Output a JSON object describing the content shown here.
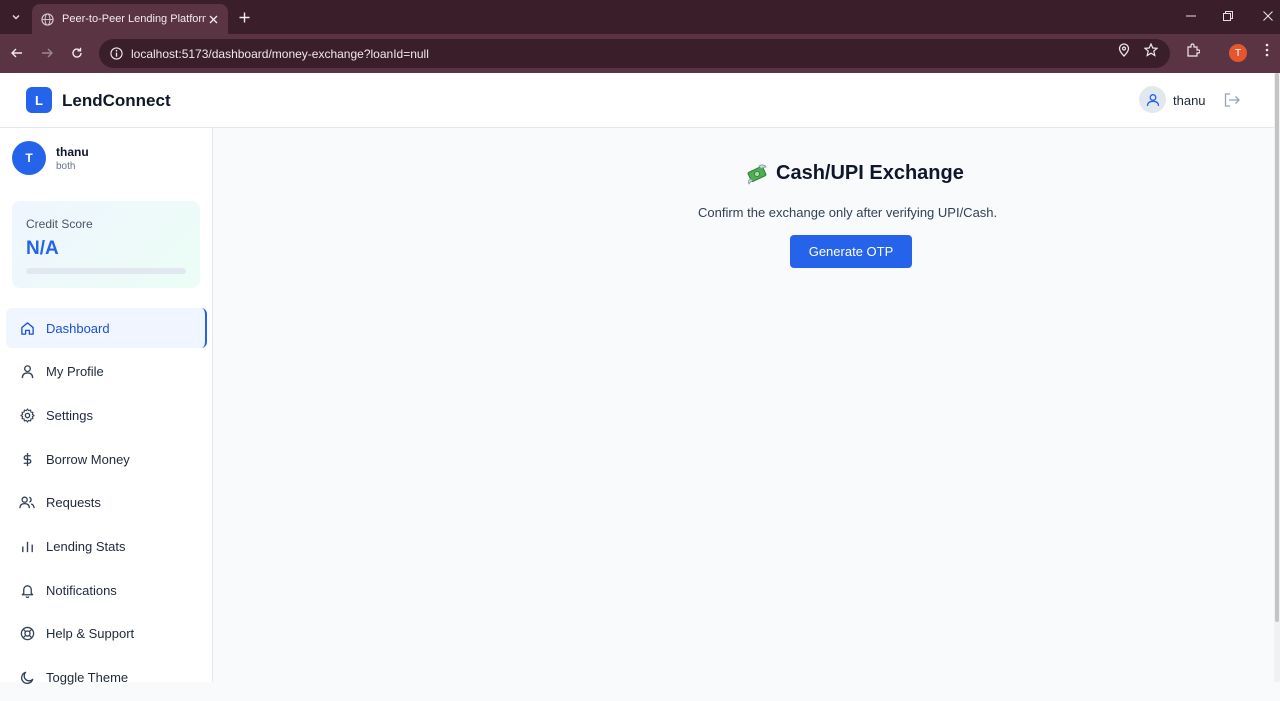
{
  "browser": {
    "tab_title": "Peer-to-Peer Lending Platform",
    "url": "localhost:5173/dashboard/money-exchange?loanId=null",
    "profile_initial": "T"
  },
  "header": {
    "logo_letter": "L",
    "brand": "LendConnect",
    "user_name": "thanu"
  },
  "sidebar": {
    "avatar_initial": "T",
    "user_name": "thanu",
    "role": "both",
    "credit": {
      "label": "Credit Score",
      "value": "N/A",
      "progress_fraction": 0
    },
    "items": [
      {
        "label": "Dashboard",
        "icon": "home-icon",
        "active": true
      },
      {
        "label": "My Profile",
        "icon": "user-icon",
        "active": false
      },
      {
        "label": "Settings",
        "icon": "gear-icon",
        "active": false
      },
      {
        "label": "Borrow Money",
        "icon": "dollar-icon",
        "active": false
      },
      {
        "label": "Requests",
        "icon": "users-icon",
        "active": false
      },
      {
        "label": "Lending Stats",
        "icon": "bar-chart-icon",
        "active": false
      },
      {
        "label": "Notifications",
        "icon": "bell-icon",
        "active": false
      },
      {
        "label": "Help & Support",
        "icon": "lifebuoy-icon",
        "active": false
      },
      {
        "label": "Toggle Theme",
        "icon": "moon-icon",
        "active": false
      }
    ]
  },
  "main": {
    "title": "Cash/UPI Exchange",
    "subtitle": "Confirm the exchange only after verifying UPI/Cash.",
    "otp_button": "Generate OTP"
  },
  "colors": {
    "accent": "#2563eb",
    "browser_frame": "#3a1f2b",
    "browser_toolbar": "#5b3444"
  }
}
